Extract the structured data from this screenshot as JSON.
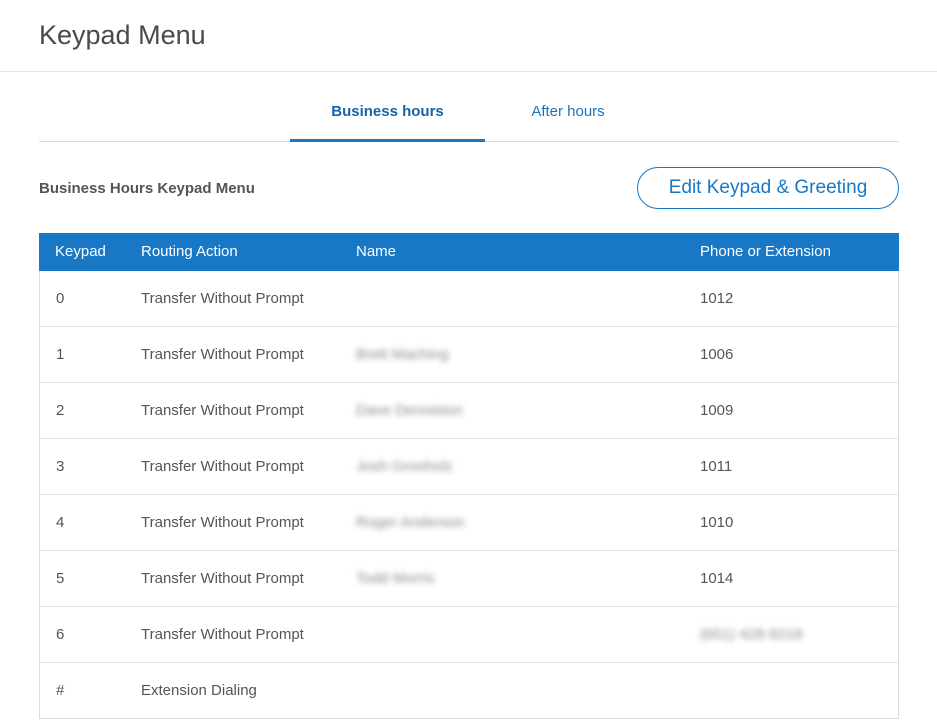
{
  "page": {
    "title": "Keypad Menu"
  },
  "tabs": [
    {
      "label": "Business hours",
      "active": true
    },
    {
      "label": "After hours",
      "active": false
    }
  ],
  "section": {
    "title": "Business Hours Keypad Menu",
    "edit_button": "Edit Keypad & Greeting"
  },
  "table": {
    "headers": [
      "Keypad",
      "Routing Action",
      "Name",
      "Phone or Extension"
    ],
    "rows": [
      {
        "keypad": "0",
        "action": "Transfer Without Prompt",
        "name": "",
        "phone": "1012"
      },
      {
        "keypad": "1",
        "action": "Transfer Without Prompt",
        "name": "Brett Maching",
        "phone": "1006"
      },
      {
        "keypad": "2",
        "action": "Transfer Without Prompt",
        "name": "Dave Denniston",
        "phone": "1009"
      },
      {
        "keypad": "3",
        "action": "Transfer Without Prompt",
        "name": "Josh Gronholz",
        "phone": "1011"
      },
      {
        "keypad": "4",
        "action": "Transfer Without Prompt",
        "name": "Roger Anderson",
        "phone": "1010"
      },
      {
        "keypad": "5",
        "action": "Transfer Without Prompt",
        "name": "Todd Morris",
        "phone": "1014"
      },
      {
        "keypad": "6",
        "action": "Transfer Without Prompt",
        "name": "",
        "phone": "(651) 428-9218"
      },
      {
        "keypad": "#",
        "action": "Extension Dialing",
        "name": "",
        "phone": ""
      }
    ]
  },
  "colors": {
    "accent": "#1878c6",
    "header_bg": "#1878c6"
  }
}
